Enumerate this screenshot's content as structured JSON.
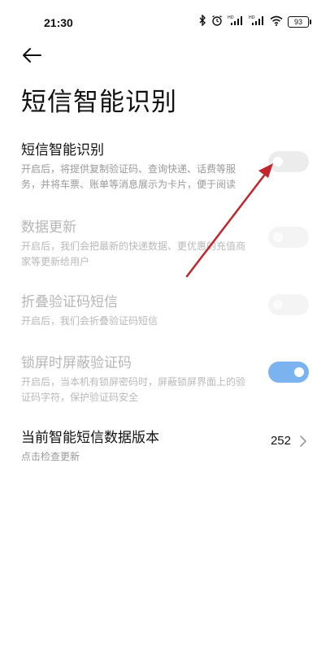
{
  "status_bar": {
    "time": "21:30",
    "battery": "93"
  },
  "page": {
    "title": "短信智能识别"
  },
  "settings": {
    "sms_recognition": {
      "title": "短信智能识别",
      "desc": "开启后，将提供复制验证码、查询快递、话费等服务，并将车票、账单等消息展示为卡片，便于阅读",
      "enabled": false
    },
    "data_update": {
      "title": "数据更新",
      "desc": "开启后，我们会把最新的快递数据、更优惠的充值商家等更新给用户",
      "enabled": false
    },
    "fold_code_sms": {
      "title": "折叠验证码短信",
      "desc": "开启后，我们会折叠验证码短信",
      "enabled": false
    },
    "hide_code_lock": {
      "title": "锁屏时屏蔽验证码",
      "desc": "开启后，当本机有锁屏密码时，屏蔽锁屏界面上的验证码字符，保护验证码安全",
      "enabled": true
    },
    "data_version": {
      "title": "当前智能短信数据版本",
      "desc": "点击检查更新",
      "value": "252"
    }
  },
  "colors": {
    "toggle_on": "#7ab3f0",
    "toggle_off": "#ececec",
    "annotation_arrow": "#c0262b"
  }
}
